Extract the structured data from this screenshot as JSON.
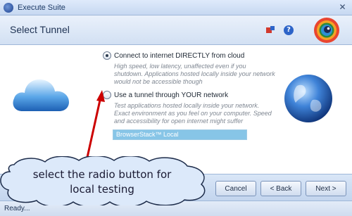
{
  "window": {
    "title": "Execute Suite",
    "close_symbol": "✕"
  },
  "header": {
    "title": "Select Tunnel",
    "help_symbol": "?"
  },
  "options": [
    {
      "label": "Connect to internet DIRECTLY from cloud",
      "selected": true,
      "description": "High speed, low latency, unaffected even if you shutdown. Applications hosted locally inside your network would not be accessible though"
    },
    {
      "label": "Use a tunnel through YOUR network",
      "selected": false,
      "description": "Test applications hosted locally inside your network. Exact environment as you feel on your computer. Speed and accessibility for open internet might suffer"
    }
  ],
  "tunnel": {
    "value": "BrowserStack™ Local"
  },
  "buttons": {
    "cancel": "Cancel",
    "back": "< Back",
    "next": "Next >"
  },
  "status": {
    "text": "Ready..."
  },
  "annotation": {
    "line1": "select the radio button for",
    "line2": "local testing"
  },
  "colors": {
    "accent": "#2d64c8",
    "annotation_arrow": "#cc0000",
    "tunnel_field": "#87c5e7"
  }
}
